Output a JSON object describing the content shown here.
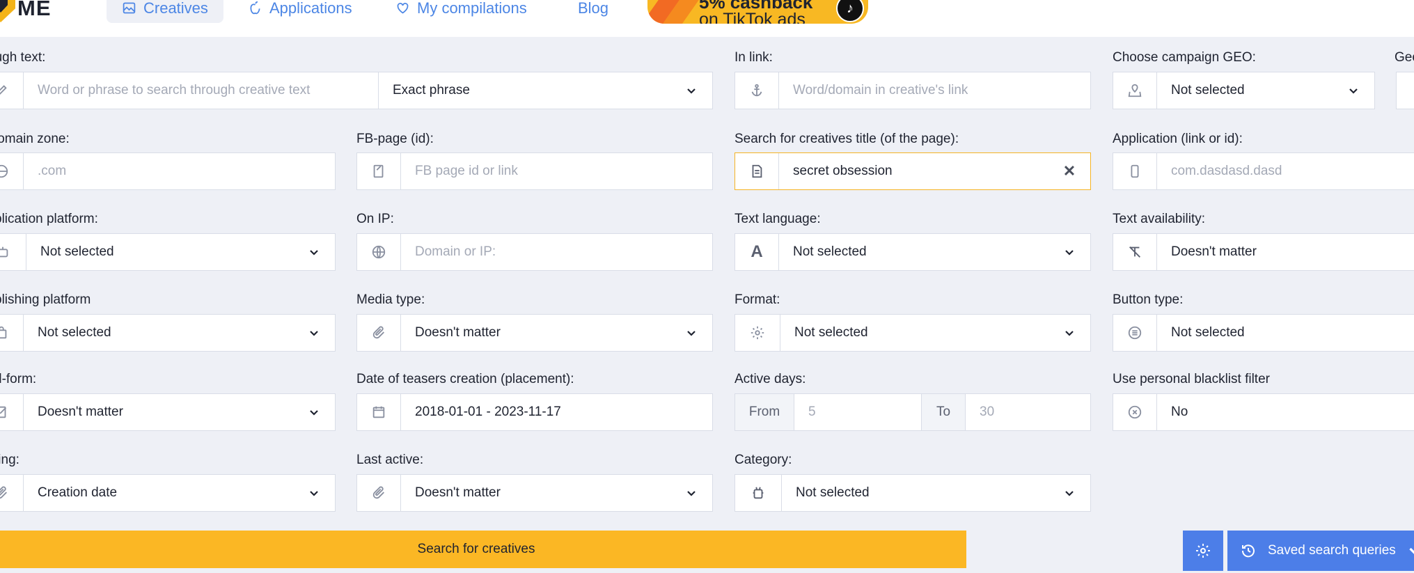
{
  "header": {
    "logo_text": "ME",
    "nav": [
      {
        "label": "Creatives",
        "icon": "image-icon"
      },
      {
        "label": "Applications",
        "icon": "apple-icon"
      },
      {
        "label": "My compilations",
        "icon": "heart-icon"
      },
      {
        "label": "Blog",
        "icon": ""
      }
    ],
    "promo": {
      "line1": "5% cashback",
      "line2": "on TikTok ads",
      "icon": "tiktok-icon"
    }
  },
  "filters": {
    "text": {
      "label": "ough text:",
      "placeholder": "Word or phrase to search through creative text",
      "mode": "Exact phrase"
    },
    "in_link": {
      "label": "In link:",
      "placeholder": "Word/domain in creative's link"
    },
    "geo": {
      "label": "Choose campaign GEO:",
      "value": "Not selected"
    },
    "geo_extra": {
      "label": "Geo"
    },
    "domain_zone": {
      "label": "lomain zone:",
      "placeholder": ".com"
    },
    "fb_page": {
      "label": "FB-page (id):",
      "placeholder": "FB page id or link"
    },
    "title": {
      "label": "Search for creatives title (of the page):",
      "value": "secret obsession",
      "clear": "✕"
    },
    "application": {
      "label": "Application (link or id):",
      "placeholder": "com.dasdasd.dasd"
    },
    "app_platform": {
      "label": "plication platform:",
      "value": "Not selected"
    },
    "on_ip": {
      "label": "On IP:",
      "placeholder": "Domain or IP:"
    },
    "text_language": {
      "label": "Text language:",
      "value": "Not selected",
      "icon_glyph": "A"
    },
    "text_availability": {
      "label": "Text availability:",
      "value": "Doesn't matter"
    },
    "pub_platform": {
      "label": "blishing platform",
      "value": "Not selected"
    },
    "media_type": {
      "label": "Media type:",
      "value": "Doesn't matter"
    },
    "format": {
      "label": "Format:",
      "value": "Not selected"
    },
    "button_type": {
      "label": "Button type:",
      "value": "Not selected"
    },
    "ad_form": {
      "label": "d-form:",
      "value": "Doesn't matter"
    },
    "date": {
      "label": "Date of teasers creation (placement):",
      "value": "2018-01-01 - 2023-11-17"
    },
    "active_days": {
      "label": "Active days:",
      "from_label": "From",
      "from_placeholder": "5",
      "to_label": "To",
      "to_placeholder": "30"
    },
    "blacklist": {
      "label": "Use personal blacklist filter",
      "value": "No"
    },
    "sorting": {
      "label": "ting:",
      "value": "Creation date"
    },
    "last_active": {
      "label": "Last active:",
      "value": "Doesn't matter"
    },
    "category": {
      "label": "Category:",
      "value": "Not selected"
    }
  },
  "actions": {
    "search": "Search for creatives",
    "saved": "Saved search queries"
  },
  "colors": {
    "accent": "#fbb724",
    "blue": "#4c7ee8",
    "link": "#4c86e5",
    "bg": "#eef0f6"
  }
}
